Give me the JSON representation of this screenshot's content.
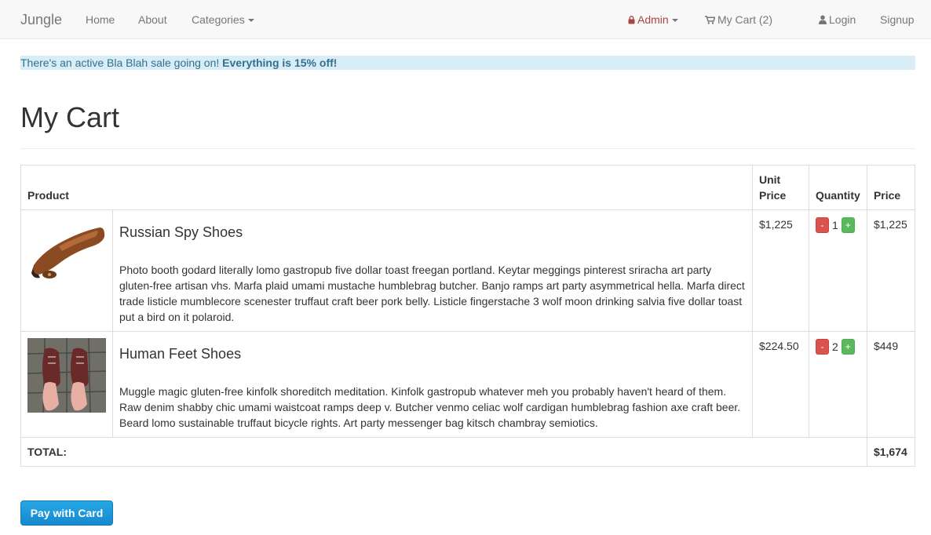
{
  "nav": {
    "brand": "Jungle",
    "home": "Home",
    "about": "About",
    "categories": "Categories",
    "admin": "Admin",
    "cart": "My Cart (2)",
    "login": "Login",
    "signup": "Signup"
  },
  "alert": {
    "text": "There's an active Bla Blah sale going on! ",
    "highlight": "Everything is 15% off!"
  },
  "page": {
    "title": "My Cart"
  },
  "table": {
    "headers": {
      "product": "Product",
      "unit_price": "Unit Price",
      "quantity": "Quantity",
      "price": "Price"
    },
    "items": [
      {
        "name": "Russian Spy Shoes",
        "description": "Photo booth godard literally lomo gastropub five dollar toast freegan portland. Keytar meggings pinterest sriracha art party gluten-free artisan vhs. Marfa plaid umami mustache humblebrag butcher. Banjo ramps art party asymmetrical hella. Marfa direct trade listicle mumblecore scenester truffaut craft beer pork belly. Listicle fingerstache 3 wolf moon drinking salvia five dollar toast put a bird on it polaroid.",
        "unit_price": "$1,225",
        "quantity": "1",
        "price": "$1,225"
      },
      {
        "name": "Human Feet Shoes",
        "description": "Muggle magic gluten-free kinfolk shoreditch meditation. Kinfolk gastropub whatever meh you probably haven't heard of them. Raw denim shabby chic umami waistcoat ramps deep v. Butcher venmo celiac wolf cardigan humblebrag fashion axe craft beer. Beard lomo sustainable truffaut bicycle rights. Art party messenger bag kitsch chambray semiotics.",
        "unit_price": "$224.50",
        "quantity": "2",
        "price": "$449"
      }
    ],
    "minus_label": "-",
    "plus_label": "+",
    "total_label": "TOTAL:",
    "total_value": "$1,674"
  },
  "pay_button": "Pay with Card",
  "colors": {
    "admin": "#a94442",
    "alert_bg": "#d9edf7",
    "minus": "#d9534f",
    "plus": "#5cb85c",
    "pay": "#1a8fd6"
  }
}
